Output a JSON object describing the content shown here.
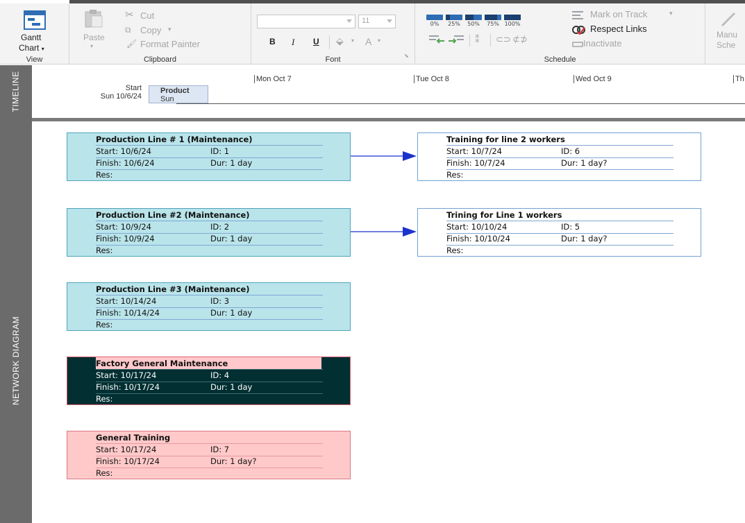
{
  "ribbon": {
    "view": {
      "gantt_line1": "Gantt",
      "gantt_line2": "Chart",
      "group_label": "View"
    },
    "clipboard": {
      "paste": "Paste",
      "cut": "Cut",
      "copy": "Copy",
      "format_painter": "Format Painter",
      "group_label": "Clipboard"
    },
    "font": {
      "font_name": "",
      "font_size": "11",
      "bold": "B",
      "italic": "I",
      "underline": "U",
      "font_color": "A",
      "group_label": "Font"
    },
    "schedule": {
      "percent_buttons": [
        "0%",
        "25%",
        "50%",
        "75%",
        "100%"
      ],
      "percent_values": [
        0,
        25,
        50,
        75,
        100
      ],
      "mark_on_track": "Mark on Track",
      "respect_links": "Respect Links",
      "inactivate": "Inactivate",
      "group_label": "Schedule"
    },
    "tasks": {
      "manual_partial_1": "Manu",
      "manual_partial_2": "Sche"
    }
  },
  "sidebar": {
    "timeline_label": "TIMELINE",
    "network_label": "NETWORK DIAGRAM"
  },
  "timeline": {
    "start_label": "Start",
    "start_date": "Sun 10/6/24",
    "dates": [
      "Mon Oct 7",
      "Tue Oct 8",
      "Wed Oct 9",
      "Th"
    ],
    "bar": {
      "title": "Product",
      "sub": "Sun"
    }
  },
  "nodes": [
    {
      "title": "Production Line # 1 (Maintenance)",
      "start": "Start:  10/6/24",
      "id": "ID:  1",
      "finish": "Finish: 10/6/24",
      "dur": "Dur: 1 day",
      "res": "Res:"
    },
    {
      "title": "Training for line 2 workers",
      "start": "Start:  10/7/24",
      "id": "ID:  6",
      "finish": "Finish: 10/7/24",
      "dur": "Dur: 1 day?",
      "res": "Res:"
    },
    {
      "title": "Production Line #2 (Maintenance)",
      "start": "Start:  10/9/24",
      "id": "ID:  2",
      "finish": "Finish: 10/9/24",
      "dur": "Dur: 1 day",
      "res": "Res:"
    },
    {
      "title": "Trining for Line 1 workers",
      "start": "Start:  10/10/24",
      "id": "ID:  5",
      "finish": "Finish: 10/10/24",
      "dur": "Dur: 1 day?",
      "res": "Res:"
    },
    {
      "title": "Production Line #3 (Maintenance)",
      "start": "Start:  10/14/24",
      "id": "ID:  3",
      "finish": "Finish: 10/14/24",
      "dur": "Dur: 1 day",
      "res": "Res:"
    },
    {
      "title": "Factory General Maintenance",
      "start": "Start:  10/17/24",
      "id": "ID:  4",
      "finish": "Finish: 10/17/24",
      "dur": "Dur: 1 day",
      "res": "Res:"
    },
    {
      "title": "General Training",
      "start": "Start:  10/17/24",
      "id": "ID:  7",
      "finish": "Finish: 10/17/24",
      "dur": "Dur: 1 day?",
      "res": "Res:"
    }
  ],
  "colors": {
    "link": "#1a33cc",
    "cyan_node": "#b9e4ea",
    "dark_node": "#022f32",
    "pink_node": "#ffc9c9",
    "sidebar": "#6b6b6b"
  }
}
